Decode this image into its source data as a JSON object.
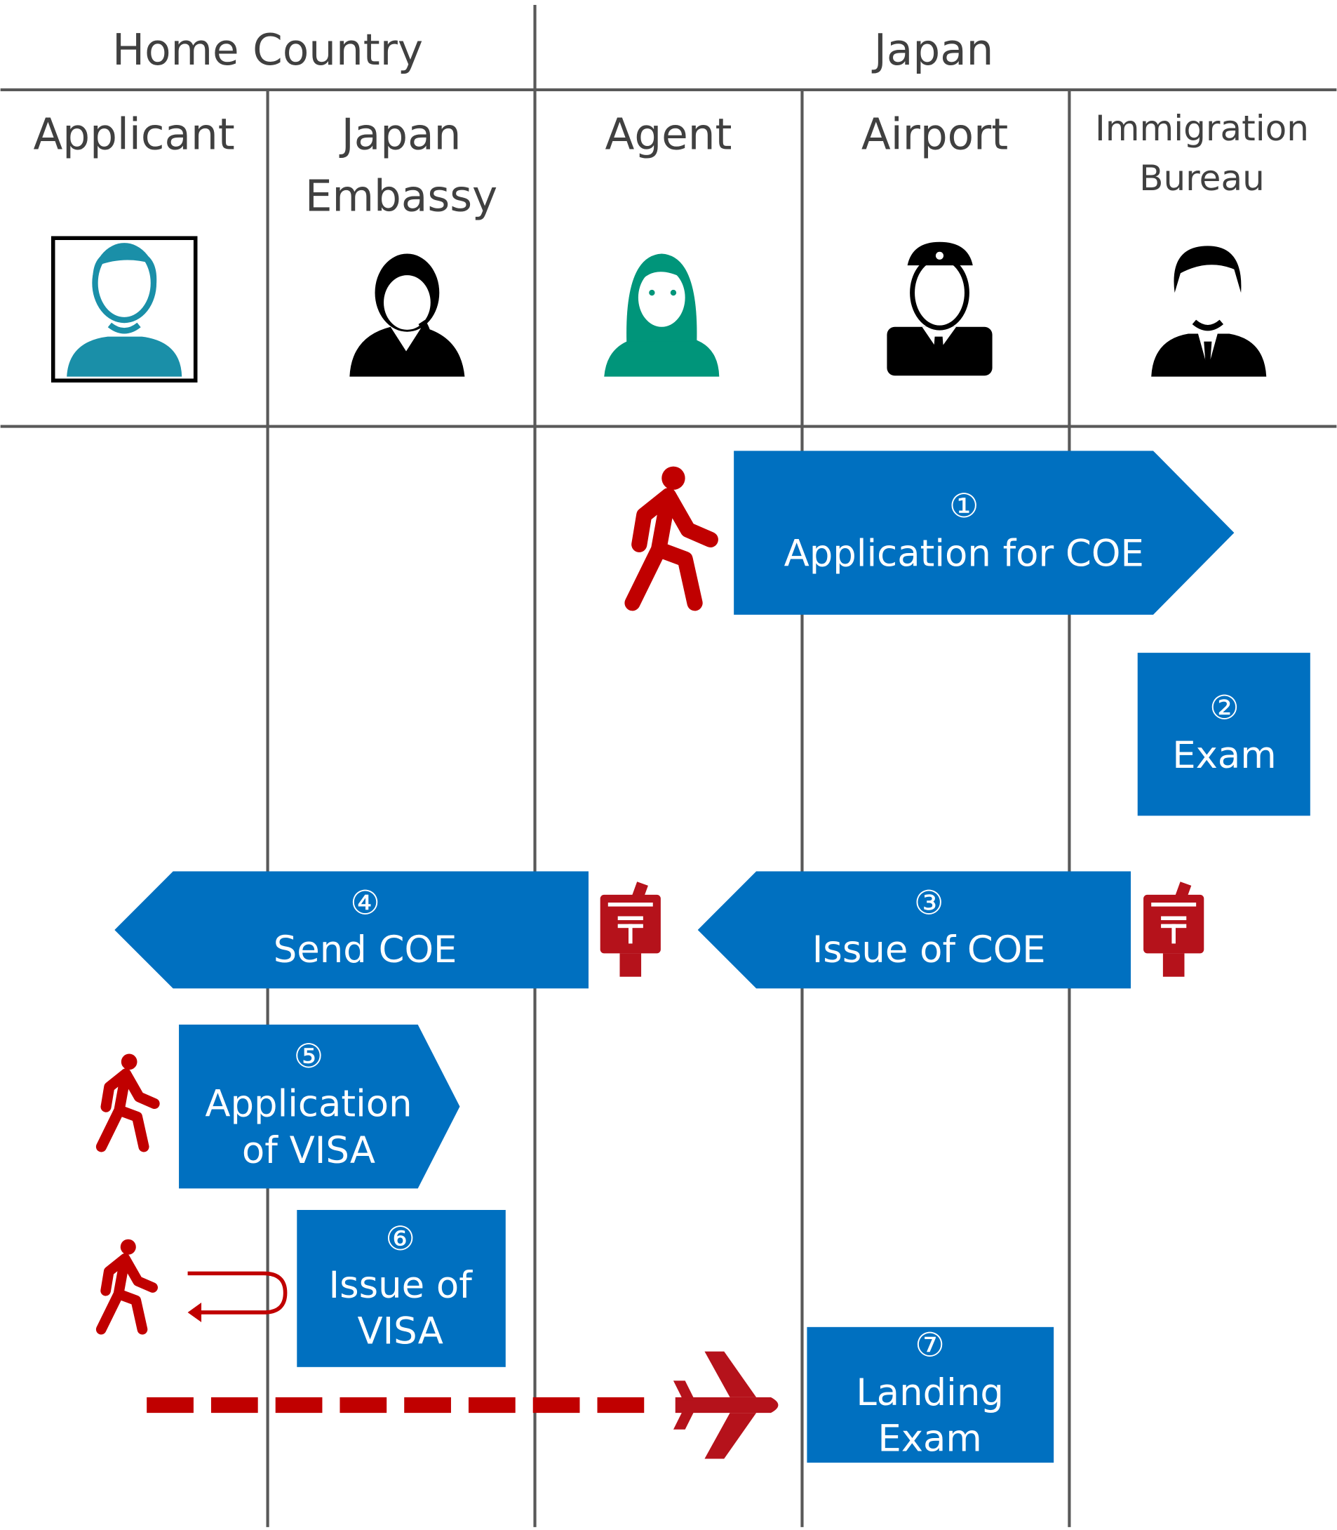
{
  "header": {
    "home_country": "Home Country",
    "japan": "Japan"
  },
  "columns": {
    "applicant": "Applicant",
    "embassy": [
      "Japan",
      "Embassy"
    ],
    "agent": "Agent",
    "airport": "Airport",
    "immigration": [
      "Immigration",
      "Bureau"
    ]
  },
  "steps": [
    {
      "num": "①",
      "lines": [
        "Application for COE"
      ]
    },
    {
      "num": "②",
      "lines": [
        "Exam"
      ]
    },
    {
      "num": "③",
      "lines": [
        "Issue of COE"
      ]
    },
    {
      "num": "④",
      "lines": [
        "Send COE"
      ]
    },
    {
      "num": "⑤",
      "lines": [
        "Application",
        "of VISA"
      ]
    },
    {
      "num": "⑥",
      "lines": [
        "Issue of",
        "VISA"
      ]
    },
    {
      "num": "⑦",
      "lines": [
        "Landing",
        "Exam"
      ]
    }
  ],
  "icons": [
    "applicant-person-icon",
    "embassy-woman-icon",
    "agent-woman-icon",
    "airport-officer-icon",
    "immigration-man-icon",
    "walking-person-icon",
    "mailbox-icon",
    "return-arrow-icon",
    "airplane-icon"
  ],
  "colors": {
    "box": "#0070C0",
    "accent_red": "#C00000",
    "applicant": "#1A8FA8",
    "agent": "#00957A",
    "lines": "#595959"
  }
}
